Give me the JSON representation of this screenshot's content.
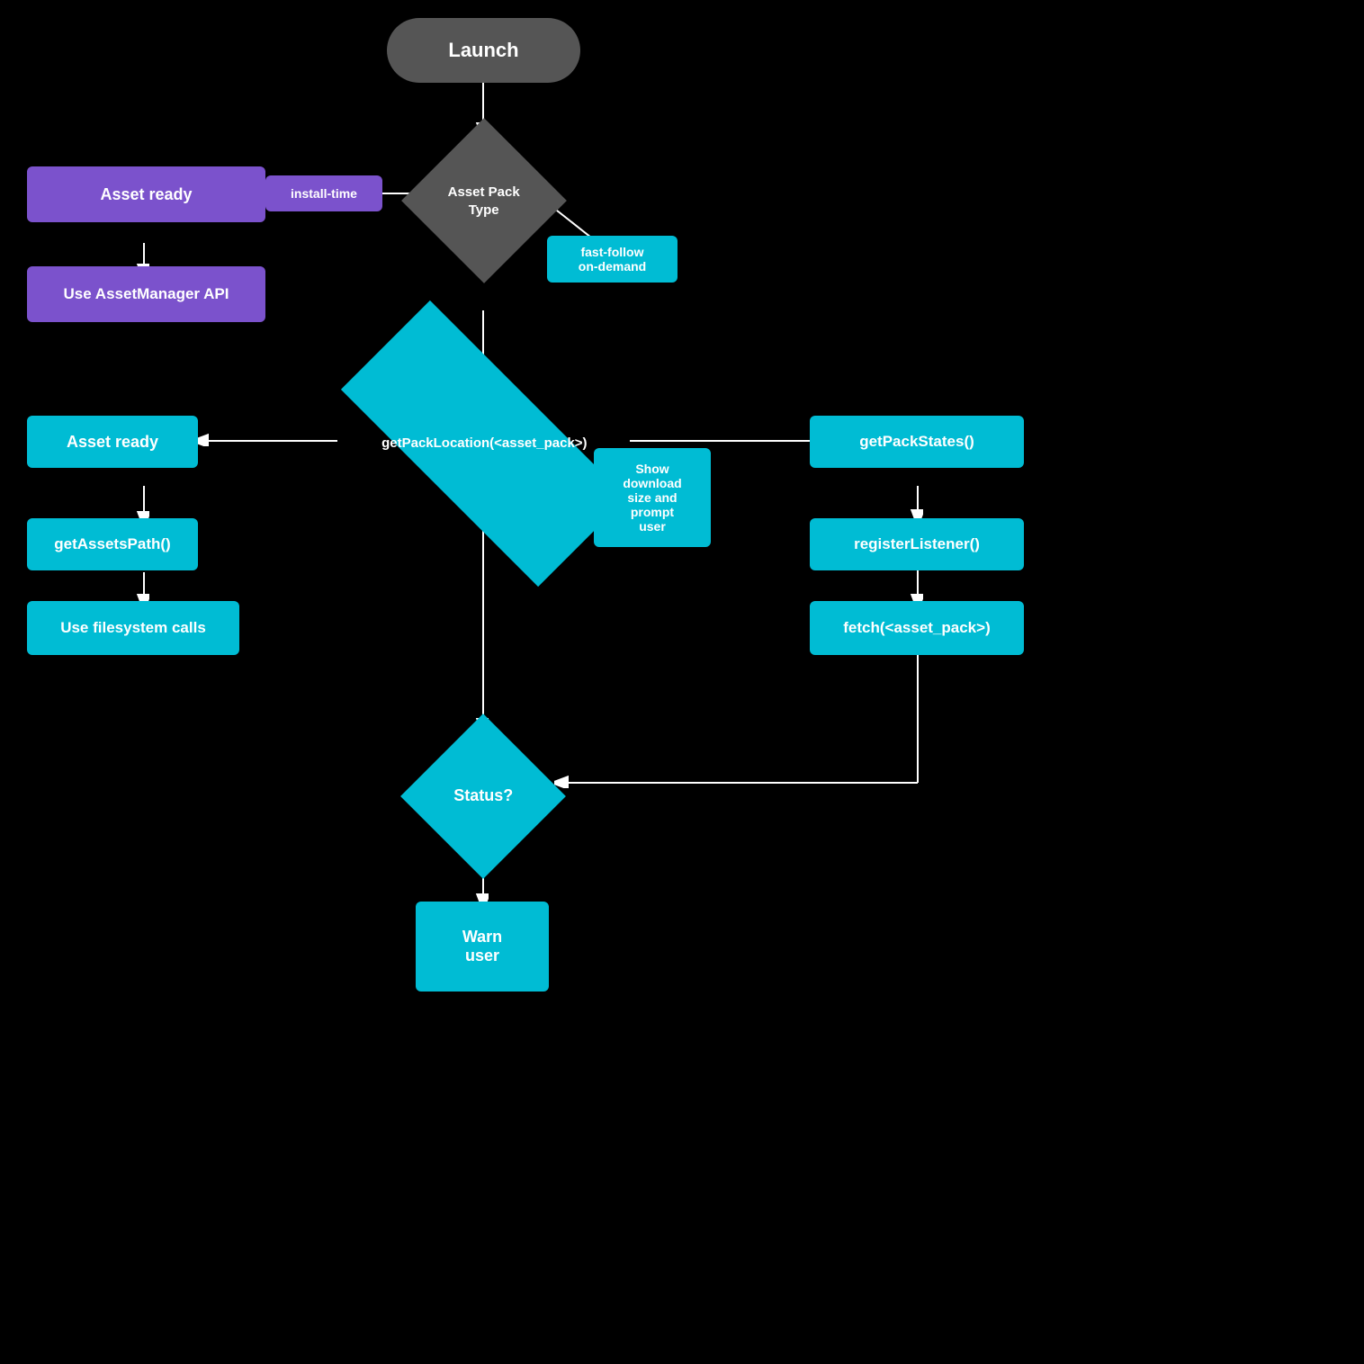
{
  "nodes": {
    "launch": {
      "label": "Launch"
    },
    "asset_pack_type": {
      "label": "Asset Pack\nType"
    },
    "install_time_badge": {
      "label": "install-time"
    },
    "fast_follow_badge": {
      "label": "fast-follow\non-demand"
    },
    "asset_ready_1": {
      "label": "Asset ready"
    },
    "use_asset_manager": {
      "label": "Use AssetManager API"
    },
    "get_pack_location": {
      "label": "getPackLocation(<asset_pack>)"
    },
    "asset_ready_2": {
      "label": "Asset ready"
    },
    "get_assets_path": {
      "label": "getAssetsPath()"
    },
    "use_filesystem": {
      "label": "Use filesystem calls"
    },
    "show_download": {
      "label": "Show\ndownload\nsize and\nprompt\nuser"
    },
    "get_pack_states": {
      "label": "getPackStates()"
    },
    "register_listener": {
      "label": "registerListener()"
    },
    "fetch_asset_pack": {
      "label": "fetch(<asset_pack>)"
    },
    "status": {
      "label": "Status?"
    },
    "warn_user": {
      "label": "Warn\nuser"
    }
  }
}
